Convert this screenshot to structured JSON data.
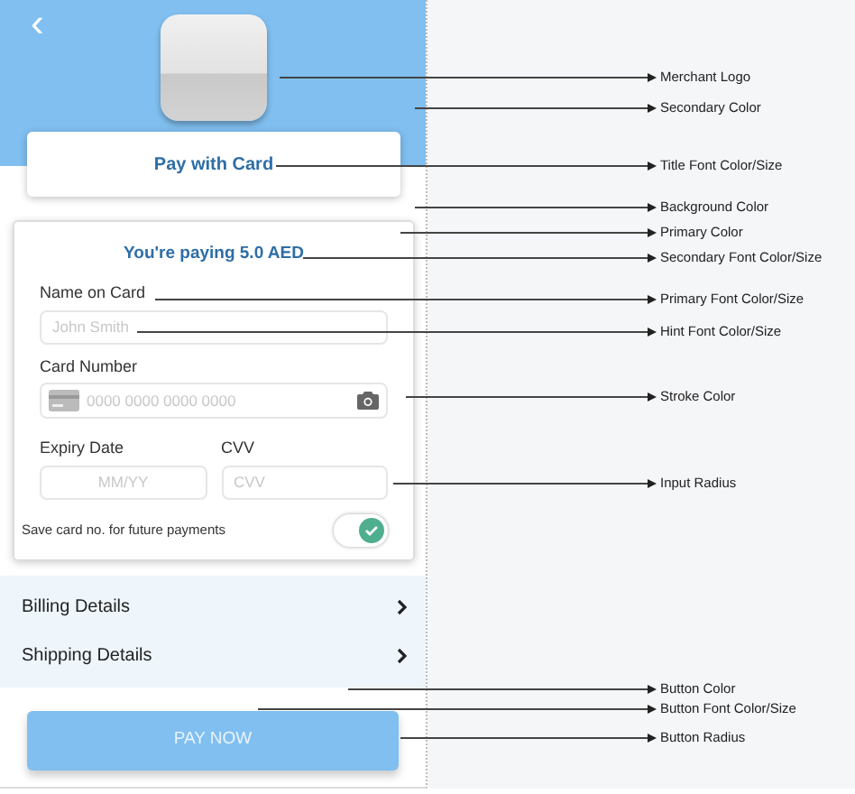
{
  "header": {
    "back_icon": "‹",
    "title": "Pay with Card"
  },
  "form": {
    "amount": "You're paying 5.0 AED",
    "name": {
      "label": "Name on Card",
      "placeholder": "John Smith"
    },
    "card": {
      "label": "Card Number",
      "placeholder": "0000 0000 0000 0000"
    },
    "expiry": {
      "label": "Expiry Date",
      "placeholder": "MM/YY"
    },
    "cvv": {
      "label": "CVV",
      "placeholder": "CVV"
    },
    "save": {
      "label": "Save card no. for future payments",
      "on": true
    }
  },
  "details": [
    {
      "label": "Billing Details"
    },
    {
      "label": "Shipping Details"
    }
  ],
  "pay_button": "PAY NOW",
  "annotations": [
    {
      "label": "Merchant Logo"
    },
    {
      "label": "Secondary Color"
    },
    {
      "label": "Title Font Color/Size"
    },
    {
      "label": "Background Color"
    },
    {
      "label": "Primary Color"
    },
    {
      "label": "Secondary Font Color/Size"
    },
    {
      "label": "Primary Font Color/Size"
    },
    {
      "label": "Hint Font Color/Size"
    },
    {
      "label": "Stroke Color"
    },
    {
      "label": "Input Radius"
    },
    {
      "label": "Button Color"
    },
    {
      "label": "Button Font Color/Size"
    },
    {
      "label": "Button Radius"
    }
  ]
}
